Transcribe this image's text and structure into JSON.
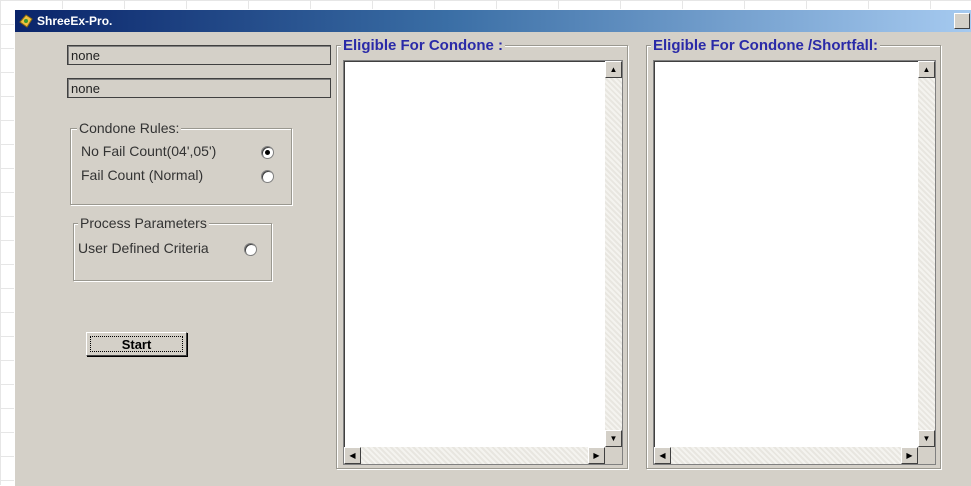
{
  "window": {
    "title": "ShreeEx-Pro.",
    "icon": "app-icon"
  },
  "textboxes": [
    {
      "value": "none"
    },
    {
      "value": "none"
    }
  ],
  "condone_rules": {
    "legend": "Condone Rules:",
    "options": [
      {
        "label": "No Fail Count(04',05')",
        "selected": true
      },
      {
        "label": "Fail Count (Normal)",
        "selected": false
      }
    ]
  },
  "process_parameters": {
    "legend": "Process Parameters",
    "options": [
      {
        "label": "User Defined Criteria",
        "selected": false
      }
    ]
  },
  "start_button": {
    "label": "Start"
  },
  "eligible_condone": {
    "legend": "Eligible For Condone :"
  },
  "eligible_shortfall": {
    "legend": "Eligible For Condone /Shortfall:"
  },
  "colors": {
    "titlebar_start": "#0a246a",
    "window_face": "#d4d0c8",
    "legend_blue": "#2a2aa8"
  }
}
